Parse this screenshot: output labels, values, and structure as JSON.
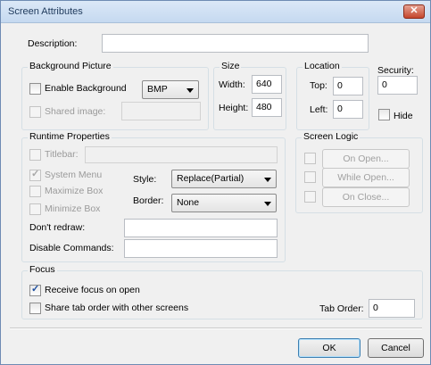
{
  "window": {
    "title": "Screen Attributes",
    "close_glyph": "✕"
  },
  "description": {
    "label": "Description:",
    "value": ""
  },
  "background_picture": {
    "group_title": "Background Picture",
    "enable_label": "Enable Background",
    "enable_checked": false,
    "format_value": "BMP",
    "shared_label": "Shared image:",
    "shared_checked": false,
    "shared_value": ""
  },
  "size": {
    "group_title": "Size",
    "width_label": "Width:",
    "width_value": "640",
    "height_label": "Height:",
    "height_value": "480"
  },
  "location": {
    "group_title": "Location",
    "top_label": "Top:",
    "top_value": "0",
    "left_label": "Left:",
    "left_value": "0"
  },
  "security": {
    "label": "Security:",
    "value": "0",
    "hide_label": "Hide",
    "hide_checked": false
  },
  "runtime": {
    "group_title": "Runtime Properties",
    "titlebar_label": "Titlebar:",
    "titlebar_value": "",
    "system_menu_label": "System Menu",
    "system_menu_checked": true,
    "maximize_label": "Maximize Box",
    "minimize_label": "Minimize Box",
    "style_label": "Style:",
    "style_value": "Replace(Partial)",
    "border_label": "Border:",
    "border_value": "None",
    "dont_redraw_label": "Don't redraw:",
    "dont_redraw_value": "",
    "disable_commands_label": "Disable Commands:",
    "disable_commands_value": ""
  },
  "screen_logic": {
    "group_title": "Screen Logic",
    "on_open": "On Open...",
    "while_open": "While Open...",
    "on_close": "On Close..."
  },
  "focus": {
    "group_title": "Focus",
    "receive_label": "Receive focus on open",
    "receive_checked": true,
    "share_label": "Share tab order with other screens",
    "share_checked": false,
    "tab_order_label": "Tab Order:",
    "tab_order_value": "0"
  },
  "buttons": {
    "ok": "OK",
    "cancel": "Cancel"
  }
}
